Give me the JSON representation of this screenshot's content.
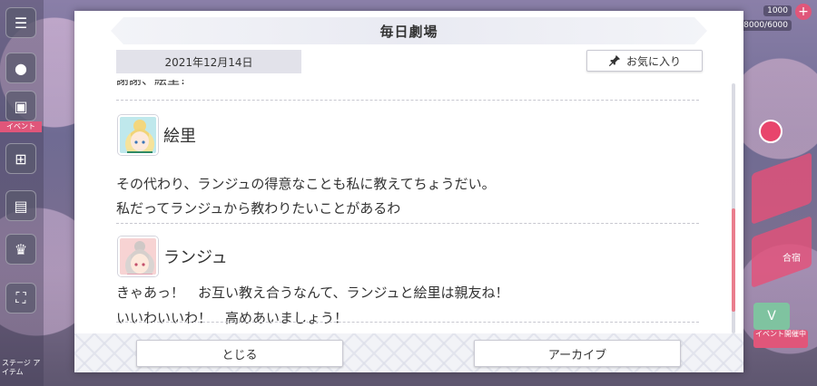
{
  "modal": {
    "title": "毎日劇場",
    "date": "2021年12月14日",
    "favorite_label": "お気に入り",
    "truncated_line": "謝謝、絵里！",
    "entries": [
      {
        "speaker": "絵里",
        "lines": [
          "その代わり、ランジュの得意なことも私に教えてちょうだい。",
          "私だってランジュから教わりたいことがあるわ"
        ]
      },
      {
        "speaker": "ランジュ",
        "lines": [
          "きゃあっ！　お互い教え合うなんて、ランジュと絵里は親友ね！",
          "いいわいいわ！　高めあいましょう！"
        ]
      }
    ],
    "close_label": "とじる",
    "archive_label": "アーカイブ",
    "scroll_position": 0.85
  },
  "background": {
    "badge": "イベント",
    "side_label": "ステージ\nアイテム",
    "stat_top": "1000",
    "stat_second": "8000/6000",
    "card_label": "合宿",
    "card_badge": "イベント開催中"
  },
  "colors": {
    "accent": "#e0567a",
    "scroll_thumb": "#ea7e8e"
  },
  "icons": {
    "pin": "pin-icon",
    "menu": "menu-icon",
    "gift": "gift-icon"
  }
}
